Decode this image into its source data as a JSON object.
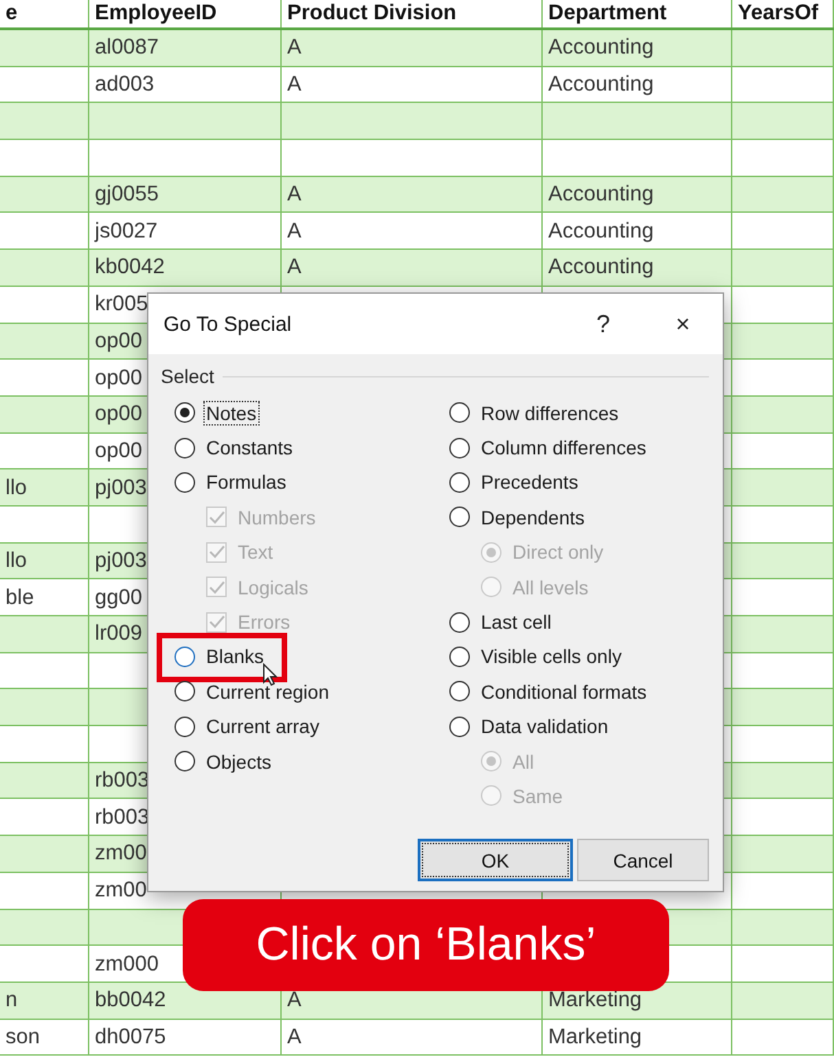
{
  "sheet": {
    "columns": [
      "e",
      "EmployeeID",
      "Product Division",
      "Department",
      "YearsOf"
    ],
    "rows": [
      {
        "id": "al0087",
        "division": "A",
        "department": "Accounting"
      },
      {
        "id": "ad003",
        "division": "A",
        "department": "Accounting"
      },
      {},
      {},
      {
        "id": "gj0055",
        "division": "A",
        "department": "Accounting"
      },
      {
        "id": "js0027",
        "division": "A",
        "department": "Accounting"
      },
      {
        "id": "kb0042",
        "division": "A",
        "department": "Accounting"
      },
      {
        "id": "kr005"
      },
      {
        "id": "op00"
      },
      {
        "id": "op00"
      },
      {
        "id": "op00"
      },
      {
        "id": "op00"
      },
      {
        "name": "llo",
        "id": "pj003"
      },
      {},
      {
        "name": "llo",
        "id": "pj003"
      },
      {
        "name": "ble",
        "id": "gg00"
      },
      {
        "id": "lr009"
      },
      {},
      {},
      {},
      {
        "id": "rb003"
      },
      {
        "id": "rb003"
      },
      {
        "id": "zm00"
      },
      {
        "id": "zm00"
      },
      {},
      {
        "id": "zm000"
      },
      {
        "name": "n",
        "id": "bb0042",
        "division": "A",
        "department": "Marketing"
      },
      {
        "name": "son",
        "id": "dh0075",
        "division": "A",
        "department": "Marketing"
      }
    ]
  },
  "dialog": {
    "title": "Go To Special",
    "help": "?",
    "close": "×",
    "group": "Select",
    "left": [
      {
        "label": "Notes",
        "selected": true,
        "focused": true,
        "highlighted": false
      },
      {
        "label": "Constants",
        "selected": false,
        "focused": false,
        "highlighted": false
      },
      {
        "label": "Formulas",
        "selected": false,
        "focused": false,
        "highlighted": false,
        "children": [
          {
            "kind": "checkbox",
            "label": "Numbers",
            "checked": true,
            "disabled": true
          },
          {
            "kind": "checkbox",
            "label": "Text",
            "checked": true,
            "disabled": true
          },
          {
            "kind": "checkbox",
            "label": "Logicals",
            "checked": true,
            "disabled": true
          },
          {
            "kind": "checkbox",
            "label": "Errors",
            "checked": true,
            "disabled": true
          }
        ]
      },
      {
        "label": "Blanks",
        "selected": false,
        "focused": false,
        "highlighted": true
      },
      {
        "label": "Current region",
        "selected": false,
        "focused": false,
        "highlighted": false
      },
      {
        "label": "Current array",
        "selected": false,
        "focused": false,
        "highlighted": false
      },
      {
        "label": "Objects",
        "selected": false,
        "focused": false,
        "highlighted": false
      }
    ],
    "right": [
      {
        "label": "Row differences",
        "selected": false,
        "focused": false,
        "highlighted": false
      },
      {
        "label": "Column differences",
        "selected": false,
        "focused": false,
        "highlighted": false
      },
      {
        "label": "Precedents",
        "selected": false,
        "focused": false,
        "highlighted": false
      },
      {
        "label": "Dependents",
        "selected": false,
        "focused": false,
        "highlighted": false,
        "children": [
          {
            "kind": "radio",
            "label": "Direct only",
            "selected": true,
            "disabled": true
          },
          {
            "kind": "radio",
            "label": "All levels",
            "selected": false,
            "disabled": true
          }
        ]
      },
      {
        "label": "Last cell",
        "selected": false,
        "focused": false,
        "highlighted": false
      },
      {
        "label": "Visible cells only",
        "selected": false,
        "focused": false,
        "highlighted": false
      },
      {
        "label": "Conditional formats",
        "selected": false,
        "focused": false,
        "highlighted": false
      },
      {
        "label": "Data validation",
        "selected": false,
        "focused": false,
        "highlighted": false,
        "children": [
          {
            "kind": "radio",
            "label": "All",
            "selected": true,
            "disabled": true
          },
          {
            "kind": "radio",
            "label": "Same",
            "selected": false,
            "disabled": true
          }
        ]
      }
    ],
    "buttons": [
      {
        "label": "OK",
        "default": true
      },
      {
        "label": "Cancel",
        "default": false
      }
    ]
  },
  "caption": "Click on ‘Blanks’"
}
